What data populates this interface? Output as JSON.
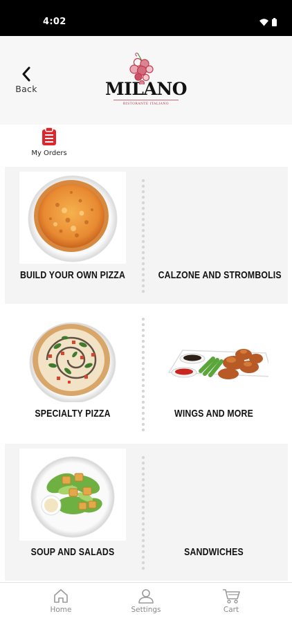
{
  "status_bar": {
    "time": "4:02",
    "icons": [
      "wifi-icon",
      "battery-icon"
    ]
  },
  "header": {
    "back_label": "Back",
    "logo": {
      "name": "MILANO",
      "tagline": "RISTORANTE ITALIANO"
    }
  },
  "my_orders": {
    "label": "My Orders",
    "icon": "clipboard-icon",
    "color": "#e0242b"
  },
  "categories": [
    {
      "label": "BUILD YOUR OWN PIZZA",
      "image": "cheese-pizza"
    },
    {
      "label": "CALZONE AND STROMBOLIS",
      "image": ""
    },
    {
      "label": "SPECIALTY PIZZA",
      "image": "specialty-pizza"
    },
    {
      "label": "WINGS AND MORE",
      "image": "chicken-wings-plate"
    },
    {
      "label": "SOUP AND SALADS",
      "image": "caesar-salad"
    },
    {
      "label": "SANDWICHES",
      "image": ""
    }
  ],
  "bottom_nav": [
    {
      "label": "Home",
      "icon": "home-icon"
    },
    {
      "label": "Settings",
      "icon": "user-icon"
    },
    {
      "label": "Cart",
      "icon": "cart-icon"
    }
  ],
  "colors": {
    "accent": "#e0242b",
    "row_gray": "#f4f4f4",
    "nav_text": "#8a8a8a"
  }
}
